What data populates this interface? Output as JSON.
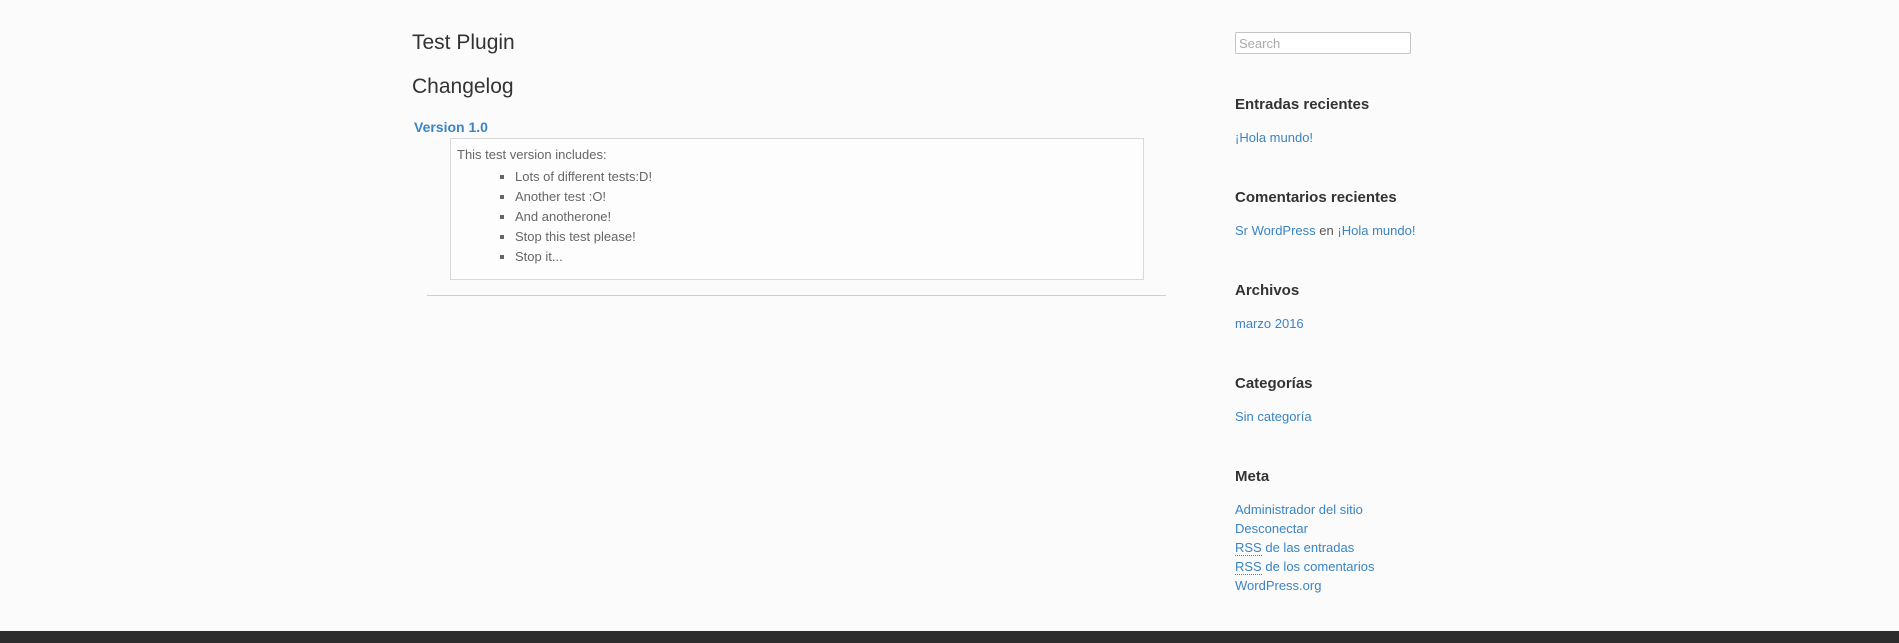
{
  "main": {
    "plugin_title": "Test Plugin",
    "changelog_heading": "Changelog",
    "version_label": "Version 1.0",
    "intro": "This test version includes:",
    "items": [
      "Lots of different tests:D!",
      "Another test :O!",
      "And anotherone!",
      "Stop this test please!",
      "Stop it..."
    ]
  },
  "sidebar": {
    "search_placeholder": "Search",
    "recent_posts": {
      "title": "Entradas recientes",
      "items": [
        "¡Hola mundo!"
      ]
    },
    "recent_comments": {
      "title": "Comentarios recientes",
      "author": "Sr WordPress",
      "connector": "en",
      "post": "¡Hola mundo!"
    },
    "archives": {
      "title": "Archivos",
      "items": [
        "marzo 2016"
      ]
    },
    "categories": {
      "title": "Categorías",
      "items": [
        "Sin categoría"
      ]
    },
    "meta": {
      "title": "Meta",
      "site_admin": "Administrador del sitio",
      "logout": "Desconectar",
      "rss_abbr": "RSS",
      "rss_entries_rest": "de las entradas",
      "rss_comments_rest": "de los comentarios",
      "wordpress_org": "WordPress.org"
    }
  },
  "colors": {
    "link": "#3a84c4",
    "heading": "#333333",
    "text": "#555555",
    "footer": "#2d2d2d",
    "background": "#fbfbfb"
  }
}
